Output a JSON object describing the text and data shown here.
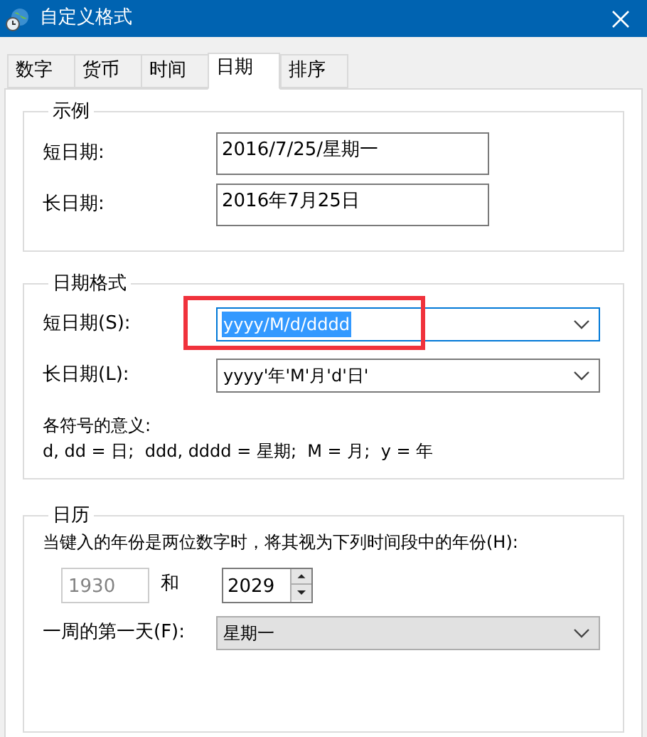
{
  "window": {
    "title": "自定义格式"
  },
  "tabs": [
    {
      "label": "数字",
      "selected": false
    },
    {
      "label": "货币",
      "selected": false
    },
    {
      "label": "时间",
      "selected": false
    },
    {
      "label": "日期",
      "selected": true
    },
    {
      "label": "排序",
      "selected": false
    }
  ],
  "example": {
    "title": "示例",
    "rows": [
      {
        "label": "短日期:",
        "value": "2016/7/25/星期一"
      },
      {
        "label": "长日期:",
        "value": "2016年7月25日"
      }
    ]
  },
  "date_formats": {
    "title": "日期格式",
    "rows": [
      {
        "label": "短日期(S):",
        "value": "yyyy/M/d/dddd",
        "focused": true,
        "highlighted": true
      },
      {
        "label": "长日期(L):",
        "value": "yyyy'年'M'月'd'日'",
        "focused": false,
        "highlighted": false
      }
    ],
    "legend_title": "各符号的意义:",
    "legend": "d, dd = 日;  ddd, dddd = 星期;  M = 月;  y = 年"
  },
  "calendar": {
    "title": "日历",
    "two_digit_label": "当键入的年份是两位数字时，将其视为下列时间段中的年份(H):",
    "from_year": {
      "value": "1930",
      "disabled": true
    },
    "and_label": "和",
    "to_year": {
      "value": "2029",
      "disabled": false
    },
    "first_day_label": "一周的第一天(F):",
    "first_day": {
      "value": "星期一",
      "disabled": true
    }
  }
}
